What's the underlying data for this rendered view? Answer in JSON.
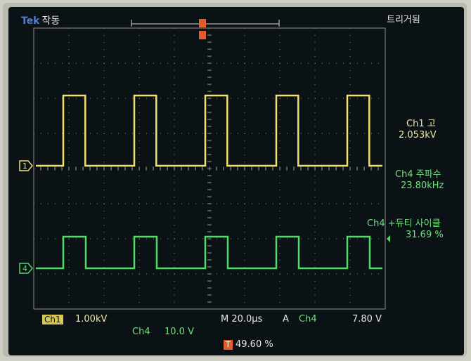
{
  "header": {
    "brand": "Tek",
    "acq_mode": "작동",
    "trigger_status": "트리거됨"
  },
  "measurements": [
    {
      "title": "Ch1 고",
      "value": "2.053kV",
      "color": "#f0e8a0"
    },
    {
      "title": "Ch4 주파수",
      "value": "23.80kHz",
      "color": "#6fe07a"
    },
    {
      "title": "Ch4 +듀티 사이클",
      "value": "31.69 %",
      "color": "#6fe07a"
    }
  ],
  "footer": {
    "ch1_label": "Ch1",
    "ch1_scale": "1.00kV",
    "ch4_label": "Ch4",
    "ch4_scale": "10.0 V",
    "timebase": "M 20.0µs",
    "trigger_mode": "A",
    "trigger_source": "Ch4",
    "trigger_level": "7.80 V",
    "trigger_position": "49.60 %",
    "trigger_badge": "T"
  },
  "channel_markers": [
    "1",
    "4"
  ],
  "colors": {
    "ch1": "#f0e070",
    "ch4": "#52d96a",
    "grid": "#8d8f7a",
    "trigger": "#e25c2c"
  },
  "waveforms": {
    "ch1": {
      "period_divs": 2.02,
      "duty": 0.31,
      "high_div": 2.0,
      "low_div": 0.0
    },
    "ch4": {
      "period_divs": 2.02,
      "duty": 0.3169,
      "high_div": 0.9,
      "low_div": 0.0
    }
  }
}
